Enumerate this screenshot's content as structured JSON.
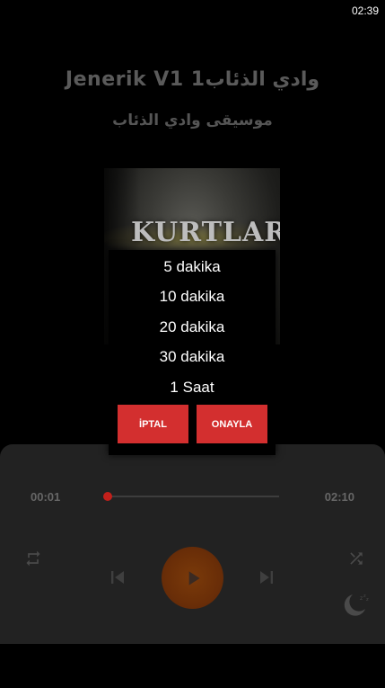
{
  "status_bar": {
    "time": "02:39"
  },
  "track": {
    "title": "Jenerik V1 1وادي الذئاب",
    "artist": "موسيقى وادي الذئاب"
  },
  "album_art": {
    "logo_text": "KURTLAR"
  },
  "player": {
    "current_time": "00:01",
    "total_time": "02:10",
    "progress_fraction": 0.0077,
    "accent_color": "#d32f2f"
  },
  "sleep_timer_dialog": {
    "options": [
      "5 dakika",
      "10 dakika",
      "20 dakika",
      "30 dakika",
      "1 Saat"
    ],
    "cancel_label": "İPTAL",
    "confirm_label": "ONAYLA"
  },
  "icons": {
    "repeat": "repeat-icon",
    "shuffle": "shuffle-icon",
    "previous": "skip-previous-icon",
    "play": "play-icon",
    "next": "skip-next-icon",
    "sleep": "sleep-moon-icon"
  }
}
